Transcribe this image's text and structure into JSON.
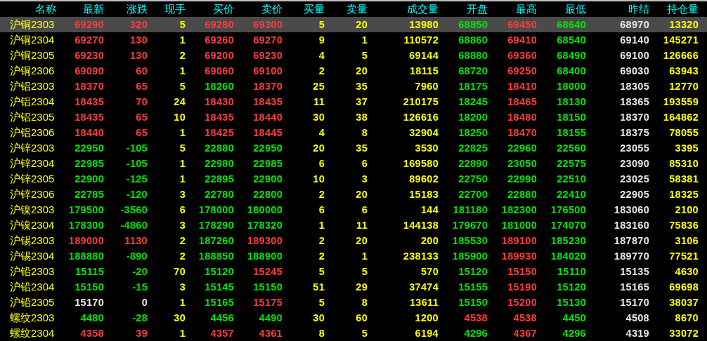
{
  "table": {
    "columns": [
      "名称",
      "最新",
      "涨跌",
      "现手",
      "买价",
      "卖价",
      "买量",
      "卖量",
      "成交量",
      "开盘",
      "最高",
      "最低",
      "昨结",
      "持仓量"
    ],
    "rows": [
      {
        "selected": true,
        "cells": [
          "沪铜2303",
          {
            "text": "69290",
            "color": "#ff3c3c"
          },
          {
            "text": "320",
            "color": "#ff3c3c"
          },
          "5",
          {
            "text": "69280",
            "color": "#ff3c3c"
          },
          {
            "text": "69300",
            "color": "#ff3c3c"
          },
          "5",
          "20",
          "13980",
          {
            "text": "68850",
            "color": "#00e600"
          },
          {
            "text": "69450",
            "color": "#ff3c3c"
          },
          {
            "text": "68640",
            "color": "#00e600"
          },
          "68970",
          "13320"
        ]
      },
      {
        "selected": false,
        "cells": [
          "沪铜2304",
          {
            "text": "69270",
            "color": "#ff3c3c"
          },
          {
            "text": "130",
            "color": "#ff3c3c"
          },
          "1",
          {
            "text": "69260",
            "color": "#ff3c3c"
          },
          {
            "text": "69270",
            "color": "#ff3c3c"
          },
          "9",
          "1",
          "110572",
          {
            "text": "68860",
            "color": "#00e600"
          },
          {
            "text": "69410",
            "color": "#ff3c3c"
          },
          {
            "text": "68540",
            "color": "#00e600"
          },
          "69140",
          "145271"
        ]
      },
      {
        "selected": false,
        "cells": [
          "沪铜2305",
          {
            "text": "69230",
            "color": "#ff3c3c"
          },
          {
            "text": "130",
            "color": "#ff3c3c"
          },
          "2",
          {
            "text": "69200",
            "color": "#ff3c3c"
          },
          {
            "text": "69230",
            "color": "#ff3c3c"
          },
          "4",
          "5",
          "69144",
          {
            "text": "68880",
            "color": "#00e600"
          },
          {
            "text": "69360",
            "color": "#ff3c3c"
          },
          {
            "text": "68490",
            "color": "#00e600"
          },
          "69100",
          "126666"
        ]
      },
      {
        "selected": false,
        "cells": [
          "沪铜2306",
          {
            "text": "69090",
            "color": "#ff3c3c"
          },
          {
            "text": "60",
            "color": "#ff3c3c"
          },
          "1",
          {
            "text": "69060",
            "color": "#ff3c3c"
          },
          {
            "text": "69100",
            "color": "#ff3c3c"
          },
          "2",
          "20",
          "18115",
          {
            "text": "68720",
            "color": "#00e600"
          },
          {
            "text": "69250",
            "color": "#ff3c3c"
          },
          {
            "text": "68400",
            "color": "#00e600"
          },
          "69030",
          "63943"
        ]
      },
      {
        "selected": false,
        "cells": [
          "沪铝2303",
          {
            "text": "18370",
            "color": "#ff3c3c"
          },
          {
            "text": "65",
            "color": "#ff3c3c"
          },
          "5",
          {
            "text": "18260",
            "color": "#00e600"
          },
          {
            "text": "18370",
            "color": "#ff3c3c"
          },
          "25",
          "35",
          "7960",
          {
            "text": "18175",
            "color": "#00e600"
          },
          {
            "text": "18410",
            "color": "#ff3c3c"
          },
          {
            "text": "18000",
            "color": "#00e600"
          },
          "18305",
          "12770"
        ]
      },
      {
        "selected": false,
        "cells": [
          "沪铝2304",
          {
            "text": "18435",
            "color": "#ff3c3c"
          },
          {
            "text": "70",
            "color": "#ff3c3c"
          },
          "24",
          {
            "text": "18430",
            "color": "#ff3c3c"
          },
          {
            "text": "18435",
            "color": "#ff3c3c"
          },
          "11",
          "37",
          "210175",
          {
            "text": "18245",
            "color": "#00e600"
          },
          {
            "text": "18465",
            "color": "#ff3c3c"
          },
          {
            "text": "18130",
            "color": "#00e600"
          },
          "18365",
          "193559"
        ]
      },
      {
        "selected": false,
        "cells": [
          "沪铝2305",
          {
            "text": "18435",
            "color": "#ff3c3c"
          },
          {
            "text": "65",
            "color": "#ff3c3c"
          },
          "10",
          {
            "text": "18435",
            "color": "#ff3c3c"
          },
          {
            "text": "18440",
            "color": "#ff3c3c"
          },
          "30",
          "38",
          "126616",
          {
            "text": "18200",
            "color": "#00e600"
          },
          {
            "text": "18480",
            "color": "#ff3c3c"
          },
          {
            "text": "18150",
            "color": "#00e600"
          },
          "18370",
          "164862"
        ]
      },
      {
        "selected": false,
        "cells": [
          "沪铝2306",
          {
            "text": "18440",
            "color": "#ff3c3c"
          },
          {
            "text": "65",
            "color": "#ff3c3c"
          },
          "1",
          {
            "text": "18425",
            "color": "#ff3c3c"
          },
          {
            "text": "18445",
            "color": "#ff3c3c"
          },
          "4",
          "8",
          "32904",
          {
            "text": "18250",
            "color": "#00e600"
          },
          {
            "text": "18470",
            "color": "#ff3c3c"
          },
          {
            "text": "18155",
            "color": "#00e600"
          },
          "18375",
          "78055"
        ]
      },
      {
        "selected": false,
        "cells": [
          "沪锌2303",
          {
            "text": "22950",
            "color": "#00e600"
          },
          {
            "text": "-105",
            "color": "#00e600"
          },
          "5",
          {
            "text": "22880",
            "color": "#00e600"
          },
          {
            "text": "22950",
            "color": "#00e600"
          },
          "20",
          "35",
          "3530",
          {
            "text": "22825",
            "color": "#00e600"
          },
          {
            "text": "22960",
            "color": "#00e600"
          },
          {
            "text": "22560",
            "color": "#00e600"
          },
          "23055",
          "3395"
        ]
      },
      {
        "selected": false,
        "cells": [
          "沪锌2304",
          {
            "text": "22985",
            "color": "#00e600"
          },
          {
            "text": "-105",
            "color": "#00e600"
          },
          "1",
          {
            "text": "22980",
            "color": "#00e600"
          },
          {
            "text": "22985",
            "color": "#00e600"
          },
          "6",
          "6",
          "169580",
          {
            "text": "22890",
            "color": "#00e600"
          },
          {
            "text": "23050",
            "color": "#00e600"
          },
          {
            "text": "22575",
            "color": "#00e600"
          },
          "23090",
          "85310"
        ]
      },
      {
        "selected": false,
        "cells": [
          "沪锌2305",
          {
            "text": "22900",
            "color": "#00e600"
          },
          {
            "text": "-125",
            "color": "#00e600"
          },
          "1",
          {
            "text": "22895",
            "color": "#00e600"
          },
          {
            "text": "22900",
            "color": "#00e600"
          },
          "10",
          "3",
          "89602",
          {
            "text": "22750",
            "color": "#00e600"
          },
          {
            "text": "22990",
            "color": "#00e600"
          },
          {
            "text": "22510",
            "color": "#00e600"
          },
          "23025",
          "58381"
        ]
      },
      {
        "selected": false,
        "cells": [
          "沪锌2306",
          {
            "text": "22785",
            "color": "#00e600"
          },
          {
            "text": "-120",
            "color": "#00e600"
          },
          "3",
          {
            "text": "22780",
            "color": "#00e600"
          },
          {
            "text": "22800",
            "color": "#00e600"
          },
          "2",
          "20",
          "15183",
          {
            "text": "22700",
            "color": "#00e600"
          },
          {
            "text": "22880",
            "color": "#00e600"
          },
          {
            "text": "22410",
            "color": "#00e600"
          },
          "22905",
          "18325"
        ]
      },
      {
        "selected": false,
        "cells": [
          "沪镍2303",
          {
            "text": "179500",
            "color": "#00e600"
          },
          {
            "text": "-3560",
            "color": "#00e600"
          },
          "6",
          {
            "text": "178000",
            "color": "#00e600"
          },
          {
            "text": "180000",
            "color": "#00e600"
          },
          "6",
          "6",
          "144",
          {
            "text": "181180",
            "color": "#00e600"
          },
          {
            "text": "182300",
            "color": "#00e600"
          },
          {
            "text": "176500",
            "color": "#00e600"
          },
          "183060",
          "2100"
        ]
      },
      {
        "selected": false,
        "cells": [
          "沪镍2304",
          {
            "text": "178300",
            "color": "#00e600"
          },
          {
            "text": "-4860",
            "color": "#00e600"
          },
          "3",
          {
            "text": "178290",
            "color": "#00e600"
          },
          {
            "text": "178320",
            "color": "#00e600"
          },
          "1",
          "11",
          "144138",
          {
            "text": "179670",
            "color": "#00e600"
          },
          {
            "text": "181000",
            "color": "#00e600"
          },
          {
            "text": "174070",
            "color": "#00e600"
          },
          "183160",
          "75836"
        ]
      },
      {
        "selected": false,
        "cells": [
          "沪锡2303",
          {
            "text": "189000",
            "color": "#ff3c3c"
          },
          {
            "text": "1130",
            "color": "#ff3c3c"
          },
          "2",
          {
            "text": "187260",
            "color": "#00e600"
          },
          {
            "text": "189300",
            "color": "#ff3c3c"
          },
          "2",
          "20",
          "200",
          {
            "text": "185530",
            "color": "#00e600"
          },
          {
            "text": "189100",
            "color": "#ff3c3c"
          },
          {
            "text": "185230",
            "color": "#00e600"
          },
          "187870",
          "3106"
        ]
      },
      {
        "selected": false,
        "cells": [
          "沪锡2304",
          {
            "text": "188880",
            "color": "#00e600"
          },
          {
            "text": "-890",
            "color": "#00e600"
          },
          "2",
          {
            "text": "188850",
            "color": "#00e600"
          },
          {
            "text": "188900",
            "color": "#00e600"
          },
          "2",
          "1",
          "238133",
          {
            "text": "185900",
            "color": "#00e600"
          },
          {
            "text": "189930",
            "color": "#ff3c3c"
          },
          {
            "text": "184020",
            "color": "#00e600"
          },
          "189770",
          "77521"
        ]
      },
      {
        "selected": false,
        "cells": [
          "沪铅2303",
          {
            "text": "15115",
            "color": "#00e600"
          },
          {
            "text": "-20",
            "color": "#00e600"
          },
          "70",
          {
            "text": "15120",
            "color": "#00e600"
          },
          {
            "text": "15245",
            "color": "#ff3c3c"
          },
          "5",
          "5",
          "570",
          {
            "text": "15120",
            "color": "#00e600"
          },
          {
            "text": "15150",
            "color": "#ff3c3c"
          },
          {
            "text": "15110",
            "color": "#00e600"
          },
          "15135",
          "4630"
        ]
      },
      {
        "selected": false,
        "cells": [
          "沪铅2304",
          {
            "text": "15150",
            "color": "#00e600"
          },
          {
            "text": "-15",
            "color": "#00e600"
          },
          "3",
          {
            "text": "15145",
            "color": "#00e600"
          },
          {
            "text": "15150",
            "color": "#00e600"
          },
          "51",
          "29",
          "37474",
          {
            "text": "15155",
            "color": "#00e600"
          },
          {
            "text": "15190",
            "color": "#ff3c3c"
          },
          {
            "text": "15120",
            "color": "#00e600"
          },
          "15165",
          "69698"
        ]
      },
      {
        "selected": false,
        "cells": [
          "沪铅2305",
          {
            "text": "15170",
            "color": "#e8e8e8"
          },
          {
            "text": "0",
            "color": "#e8e8e8"
          },
          "1",
          {
            "text": "15165",
            "color": "#00e600"
          },
          {
            "text": "15175",
            "color": "#ff3c3c"
          },
          "5",
          "8",
          "13611",
          {
            "text": "15150",
            "color": "#00e600"
          },
          {
            "text": "15200",
            "color": "#ff3c3c"
          },
          {
            "text": "15130",
            "color": "#00e600"
          },
          "15170",
          "38037"
        ]
      },
      {
        "selected": false,
        "cells": [
          "螺纹2303",
          {
            "text": "4480",
            "color": "#00e600"
          },
          {
            "text": "-28",
            "color": "#00e600"
          },
          "30",
          {
            "text": "4456",
            "color": "#00e600"
          },
          {
            "text": "4490",
            "color": "#00e600"
          },
          "30",
          "60",
          "1200",
          {
            "text": "4538",
            "color": "#ff3c3c"
          },
          {
            "text": "4538",
            "color": "#ff3c3c"
          },
          {
            "text": "4450",
            "color": "#00e600"
          },
          "4508",
          "8670"
        ]
      },
      {
        "selected": false,
        "cells": [
          "螺纹2304",
          {
            "text": "4358",
            "color": "#ff3c3c"
          },
          {
            "text": "39",
            "color": "#ff3c3c"
          },
          "1",
          {
            "text": "4357",
            "color": "#ff3c3c"
          },
          {
            "text": "4361",
            "color": "#ff3c3c"
          },
          "8",
          "5",
          "6194",
          {
            "text": "4296",
            "color": "#00e600"
          },
          {
            "text": "4367",
            "color": "#ff3c3c"
          },
          {
            "text": "4296",
            "color": "#00e600"
          },
          "4319",
          "33072"
        ]
      }
    ]
  }
}
